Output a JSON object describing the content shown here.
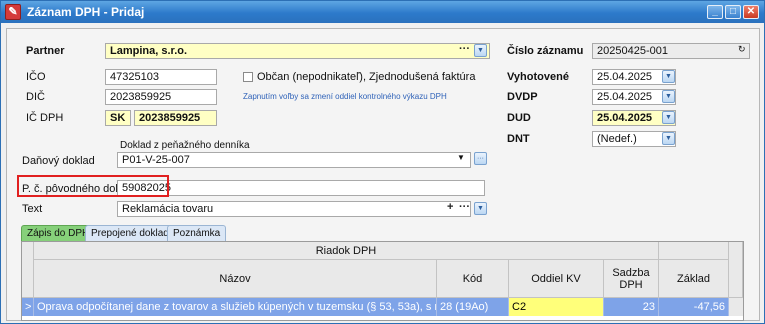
{
  "window": {
    "title": "Záznam DPH - Pridaj",
    "controls": [
      "_",
      "□",
      "✕"
    ]
  },
  "partner": {
    "label": "Partner",
    "value": "Lampina, s.r.o.",
    "more": "···"
  },
  "ico": {
    "label": "IČO",
    "value": "47325103"
  },
  "dic": {
    "label": "DIČ",
    "value": "2023859925"
  },
  "ic_dph": {
    "label": "IČ DPH",
    "prefix": "SK",
    "value": "2023859925"
  },
  "obcan": {
    "label": "Občan (nepodnikateľ), Zjednodušená faktúra",
    "note": "Zapnutím voľby sa zmení oddiel kontrolného výkazu DPH"
  },
  "cislo_zaznamu": {
    "label": "Číslo záznamu",
    "value": "20250425-001"
  },
  "vyhotovene": {
    "label": "Vyhotovené",
    "value": "25.04.2025"
  },
  "dvdp": {
    "label": "DVDP",
    "value": "25.04.2025"
  },
  "dud": {
    "label": "DUD",
    "value": "25.04.2025"
  },
  "dnt": {
    "label": "DNT",
    "value": "(Nedef.)"
  },
  "danovy_doklad": {
    "label": "Daňový doklad",
    "sublabel": "Doklad z peňažného denníka",
    "value": "P01-V-25-007"
  },
  "povodny_doklad": {
    "label": "P. č. pôvodného dokladu",
    "value": "59082025"
  },
  "text": {
    "label": "Text",
    "value": "Reklamácia tovaru",
    "plus": "+",
    "more": "···"
  },
  "tabs": [
    "Zápis do DPH",
    "Prepojené doklady",
    "Poznámka"
  ],
  "grid": {
    "group_header": "Riadok DPH",
    "columns": [
      "Názov",
      "Kód",
      "Oddiel KV",
      "Sadzba DPH",
      "Základ"
    ],
    "rows": [
      {
        "marker": ">",
        "nazov": "Oprava odpočítanej dane z tovarov a služieb kúpených v tuzemsku (§ 53, 53a), s možnosť",
        "kod": "28 (19Ao)",
        "oddiel": "C2",
        "sadzba": "23",
        "zaklad": "-47,56"
      }
    ]
  },
  "colors": {
    "title_bar": "#2d7acb",
    "yellow_field": "#ffffc4",
    "selected_row": "#7ea3e8",
    "highlight": "#e12020",
    "active_tab": "#86d07a"
  }
}
